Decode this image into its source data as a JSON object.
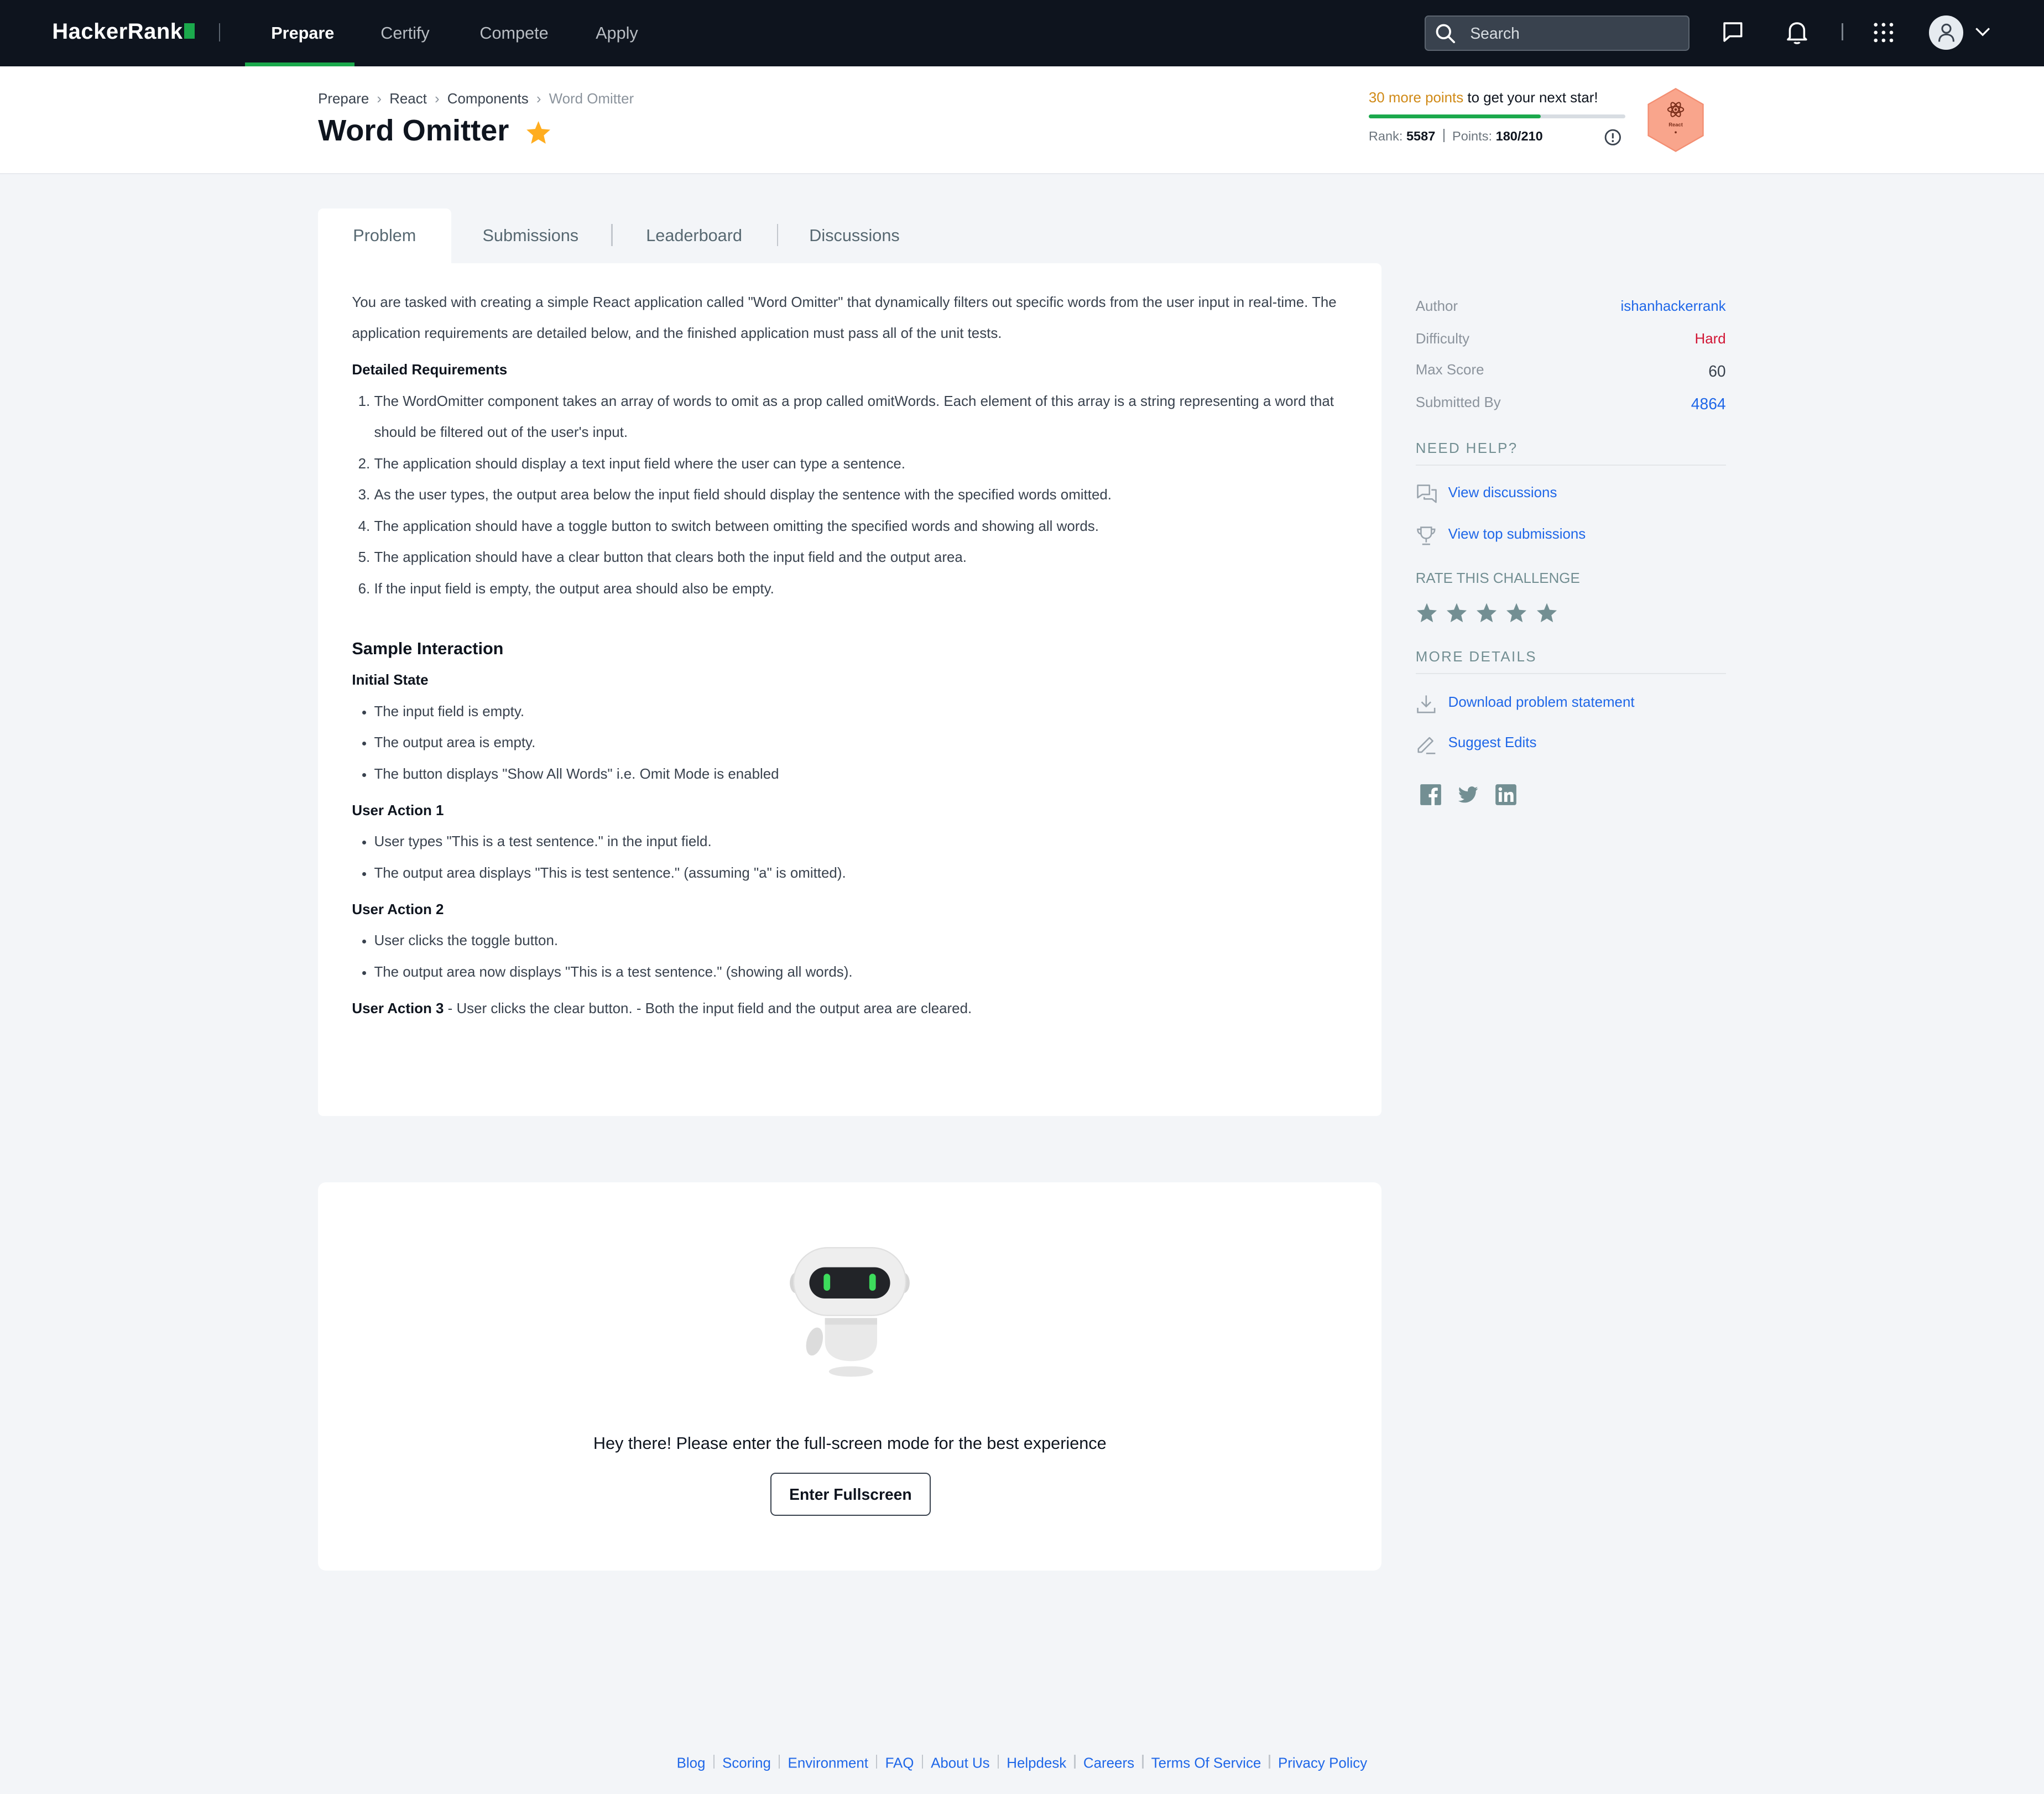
{
  "nav": {
    "logo": "HackerRank",
    "links": [
      "Prepare",
      "Certify",
      "Compete",
      "Apply"
    ],
    "active": "Prepare",
    "search_placeholder": "Search"
  },
  "breadcrumb": [
    "Prepare",
    "React",
    "Components",
    "Word Omitter"
  ],
  "title": "Word Omitter",
  "progress": {
    "points_highlight": "30 more points",
    "points_rest": " to get your next star!",
    "fraction": 0.67,
    "rank_label": "Rank:",
    "rank_value": "5587",
    "points_label": "Points:",
    "points_value": "180/210",
    "badge_label": "React"
  },
  "tabs": [
    "Problem",
    "Submissions",
    "Leaderboard",
    "Discussions"
  ],
  "problem": {
    "intro": "You are tasked with creating a simple React application called \"Word Omitter\" that dynamically filters out specific words from the user input in real-time. The application requirements are detailed below, and the finished application must pass all of the unit tests.",
    "req_heading": "Detailed Requirements",
    "requirements": [
      "The WordOmitter component takes an array of words to omit as a prop called omitWords. Each element of this array is a string representing a word that should be filtered out of the user's input.",
      "The application should display a text input field where the user can type a sentence.",
      "As the user types, the output area below the input field should display the sentence with the specified words omitted.",
      "The application should have a toggle button to switch between omitting the specified words and showing all words.",
      "The application should have a clear button that clears both the input field and the output area.",
      "If the input field is empty, the output area should also be empty."
    ],
    "sample_heading": "Sample Interaction",
    "initial_heading": "Initial State",
    "initial_items": [
      "The input field is empty.",
      "The output area is empty.",
      "The button displays \"Show All Words\" i.e. Omit Mode is enabled"
    ],
    "action1_heading": "User Action 1",
    "action1_items": [
      "User types \"This is a test sentence.\" in the input field.",
      "The output area displays \"This is test sentence.\" (assuming \"a\" is omitted)."
    ],
    "action2_heading": "User Action 2",
    "action2_items": [
      "User clicks the toggle button.",
      "The output area now displays \"This is a test sentence.\" (showing all words)."
    ],
    "action3_heading": "User Action 3",
    "action3_text": " - User clicks the clear button. - Both the input field and the output area are cleared."
  },
  "sidebar": {
    "author_label": "Author",
    "author": "ishanhackerrank",
    "difficulty_label": "Difficulty",
    "difficulty": "Hard",
    "max_score_label": "Max Score",
    "max_score": "60",
    "submitted_label": "Submitted By",
    "submitted": "4864",
    "need_help": "NEED HELP?",
    "view_discussions": "View discussions",
    "view_top": "View top submissions",
    "rate": "RATE THIS CHALLENGE",
    "more_details": "MORE DETAILS",
    "download": "Download problem statement",
    "suggest": "Suggest Edits"
  },
  "fullscreen": {
    "message": "Hey there! Please enter the full-screen mode for the best experience",
    "button": "Enter Fullscreen"
  },
  "footer": [
    "Blog",
    "Scoring",
    "Environment",
    "FAQ",
    "About Us",
    "Helpdesk",
    "Careers",
    "Terms Of Service",
    "Privacy Policy"
  ],
  "colors": {
    "nav_bg": "#0e141e",
    "accent_green": "#1ba94c",
    "link_blue": "#1f67e8",
    "hard_red": "#d11534",
    "points_orange": "#d08a17",
    "star_gold": "#ffad1f",
    "badge_fill": "#f9a58c"
  }
}
